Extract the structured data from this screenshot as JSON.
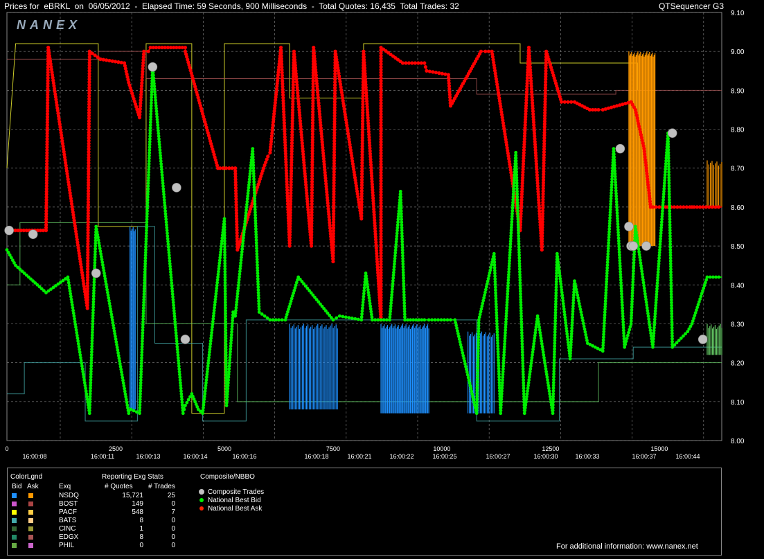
{
  "header": {
    "left": "Prices for  eBRKL  on  06/05/2012  -  Elapsed Time: 59 Seconds, 900 Milliseconds  -  Total Quotes: 16,435  Total Trades: 32",
    "right": "QTSequencer G3"
  },
  "logo": "NANEX",
  "colors": {
    "bid": "#00ee00",
    "ask": "#ff0000",
    "trade": "#c0c0c0",
    "nsdq_bid": "#1e90ff",
    "nsdq_ask": "#ff9900",
    "pacf_bid": "#ffff33",
    "pacf_ask": "#ffcc00",
    "grid": "#777777"
  },
  "chart_data": {
    "type": "line",
    "y_ticks": [
      "9.10",
      "9.00",
      "8.90",
      "8.80",
      "8.70",
      "8.60",
      "8.50",
      "8.40",
      "8.30",
      "8.20",
      "8.10",
      "8.00"
    ],
    "ylim": [
      8.0,
      9.1
    ],
    "x_ticks": [
      "0",
      "2500",
      "5000",
      "7500",
      "10000",
      "12500",
      "15000"
    ],
    "xlim": [
      0,
      16435
    ],
    "time_labels": [
      {
        "seq": 1000,
        "label": "16:00:08"
      },
      {
        "seq": 3250,
        "label": "16:00:11"
      },
      {
        "seq": 5000,
        "label": "16:00:13"
      },
      {
        "seq": 6450,
        "label": "16:00:14"
      },
      {
        "seq": 8600,
        "label": "16:00:16"
      },
      {
        "seq": 10900,
        "label": "16:00:18"
      },
      {
        "seq": 11950,
        "label": "16:00:21"
      },
      {
        "seq": 13850,
        "label": "16:00:22"
      },
      {
        "seq": 15150,
        "label": "16:00:25"
      },
      {
        "seq": 16000,
        "label": "16:00:27"
      },
      {
        "seq": 15800,
        "label": "16:00:30"
      },
      {
        "seq": 14300,
        "label": "16:00:33"
      },
      {
        "seq": 15650,
        "label": "16:00:37"
      },
      {
        "seq": 16250,
        "label": "16:00:44"
      }
    ],
    "series": [
      {
        "name": "National Best Ask",
        "x": [
          0,
          900,
          950,
          1850,
          1900,
          2150,
          2150,
          2700,
          2800,
          3050,
          3150,
          3250,
          3300,
          4100,
          4100,
          4850,
          4900,
          5250,
          5300,
          5900,
          6000,
          6050,
          6300,
          6500,
          6600,
          7000,
          7050,
          7500,
          7550,
          8150,
          8200,
          8600,
          8600,
          9100,
          9600,
          9650,
          10150,
          10200,
          10900,
          11000,
          11150,
          11800,
          12000,
          12300,
          12400,
          12750,
          13050,
          13400,
          13600,
          13700,
          14350,
          14450,
          14650,
          14800,
          14850,
          15150,
          15200,
          15700,
          15750,
          15800,
          16000,
          16435
        ],
        "y": [
          8.54,
          8.54,
          9.01,
          8.34,
          9.0,
          8.98,
          8.98,
          8.97,
          8.92,
          8.83,
          9.0,
          9.0,
          9.01,
          9.01,
          9.0,
          8.7,
          8.7,
          8.7,
          8.49,
          8.7,
          8.73,
          8.74,
          9.01,
          8.5,
          9.0,
          8.5,
          9.01,
          8.46,
          9.0,
          8.57,
          9.0,
          8.31,
          9.01,
          8.97,
          8.97,
          8.95,
          8.94,
          8.86,
          9.0,
          9.0,
          9.0,
          8.54,
          9.01,
          8.49,
          9.0,
          8.87,
          8.87,
          8.85,
          8.85,
          8.85,
          8.87,
          8.85,
          8.75,
          8.6,
          8.6,
          8.6,
          8.6,
          8.6,
          8.6,
          8.6,
          8.6,
          8.6
        ]
      },
      {
        "name": "National Best Bid",
        "x": [
          0,
          200,
          900,
          1400,
          1900,
          2050,
          2800,
          2850,
          3050,
          3350,
          4050,
          4100,
          4250,
          4400,
          4500,
          5000,
          5050,
          5200,
          5250,
          5650,
          5800,
          6050,
          6250,
          6400,
          6700,
          7500,
          7650,
          8150,
          8250,
          8400,
          8800,
          9050,
          9150,
          9600,
          9700,
          10200,
          10300,
          10800,
          10850,
          11200,
          11350,
          11700,
          11900,
          12200,
          12550,
          12650,
          12950,
          13050,
          13350,
          13700,
          13950,
          14200,
          14350,
          14450,
          14850,
          15200,
          15300,
          15650,
          15750,
          16100,
          16435
        ],
        "y": [
          8.49,
          8.45,
          8.38,
          8.42,
          8.07,
          8.55,
          8.07,
          8.08,
          8.07,
          8.96,
          8.07,
          8.09,
          8.12,
          8.08,
          8.07,
          8.57,
          8.09,
          8.33,
          8.32,
          8.75,
          8.33,
          8.31,
          8.31,
          8.31,
          8.42,
          8.31,
          8.32,
          8.31,
          8.43,
          8.31,
          8.31,
          8.64,
          8.31,
          8.31,
          8.31,
          8.31,
          8.31,
          8.07,
          8.31,
          8.48,
          8.07,
          8.74,
          8.07,
          8.32,
          8.07,
          8.48,
          8.21,
          8.41,
          8.25,
          8.23,
          8.75,
          8.24,
          8.3,
          8.55,
          8.24,
          8.79,
          8.24,
          8.28,
          8.3,
          8.42,
          8.42
        ]
      },
      {
        "name": "Composite Trades",
        "x": [
          50,
          600,
          2050,
          3350,
          3900,
          4100,
          14100,
          14300,
          14350,
          14400,
          14700,
          15300,
          16000
        ],
        "y": [
          8.54,
          8.53,
          8.43,
          8.96,
          8.65,
          8.26,
          8.75,
          8.55,
          8.5,
          8.5,
          8.5,
          8.79,
          8.26
        ]
      }
    ],
    "legend": {
      "title": "ColorLgnd",
      "col_bid": "Bid",
      "col_ask": "Ask",
      "col_exq": "Exq",
      "stats_title": "Reporting Exg Stats",
      "col_quotes": "# Quotes",
      "col_trades": "# Trades",
      "rows": [
        {
          "exq": "NSDQ",
          "quotes": "15,721",
          "trades": "25",
          "bid": "#1e90ff",
          "ask": "#ff9900"
        },
        {
          "exq": "BOST",
          "quotes": "149",
          "trades": "0",
          "bid": "#cc55cc",
          "ask": "#aa4444"
        },
        {
          "exq": "PACF",
          "quotes": "548",
          "trades": "7",
          "bid": "#ffff00",
          "ask": "#ffcc44"
        },
        {
          "exq": "BATS",
          "quotes": "8",
          "trades": "0",
          "bid": "#44aaaa",
          "ask": "#ffcc88"
        },
        {
          "exq": "CINC",
          "quotes": "1",
          "trades": "0",
          "bid": "#336633",
          "ask": "#999933"
        },
        {
          "exq": "EDGX",
          "quotes": "8",
          "trades": "0",
          "bid": "#228866",
          "ask": "#aa5555"
        },
        {
          "exq": "PHIL",
          "quotes": "0",
          "trades": "0",
          "bid": "#66aa44",
          "ask": "#cc66cc"
        }
      ],
      "composite_title": "Composite/NBBO",
      "composite_items": [
        "Composite Trades",
        "National Best Bid",
        "National Best Ask"
      ]
    },
    "footer": "For additional information: www.nanex.net"
  }
}
